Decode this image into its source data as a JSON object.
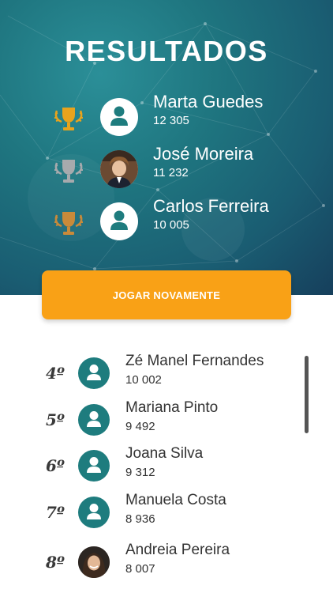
{
  "title": "RESULTADOS",
  "podium": [
    {
      "name": "Marta Guedes",
      "score": "12 305",
      "trophy": "gold-trophy-icon",
      "avatar": "default-avatar-icon"
    },
    {
      "name": "José Moreira",
      "score": "11 232",
      "trophy": "silver-trophy-icon",
      "avatar": "photo"
    },
    {
      "name": "Carlos Ferreira",
      "score": "10 005",
      "trophy": "bronze-trophy-icon",
      "avatar": "default-avatar-icon"
    }
  ],
  "play_again_label": "JOGAR NOVAMENTE",
  "ranking": [
    {
      "rank": "4º",
      "name": "Zé Manel Fernandes",
      "score": "10 002",
      "avatar": "default-avatar-icon"
    },
    {
      "rank": "5º",
      "name": "Mariana Pinto",
      "score": "9 492",
      "avatar": "default-avatar-icon"
    },
    {
      "rank": "6º",
      "name": "Joana Silva",
      "score": "9 312",
      "avatar": "default-avatar-icon"
    },
    {
      "rank": "7º",
      "name": "Manuela Costa",
      "score": "8 936",
      "avatar": "default-avatar-icon"
    },
    {
      "rank": "8º",
      "name": "Andreia Pereira",
      "score": "8 007",
      "avatar": "photo"
    }
  ],
  "colors": {
    "accent_orange": "#f9a116",
    "teal": "#1e7c7e",
    "gold": "#e8a31d",
    "silver": "#a7aaad",
    "bronze": "#c98a3a"
  }
}
